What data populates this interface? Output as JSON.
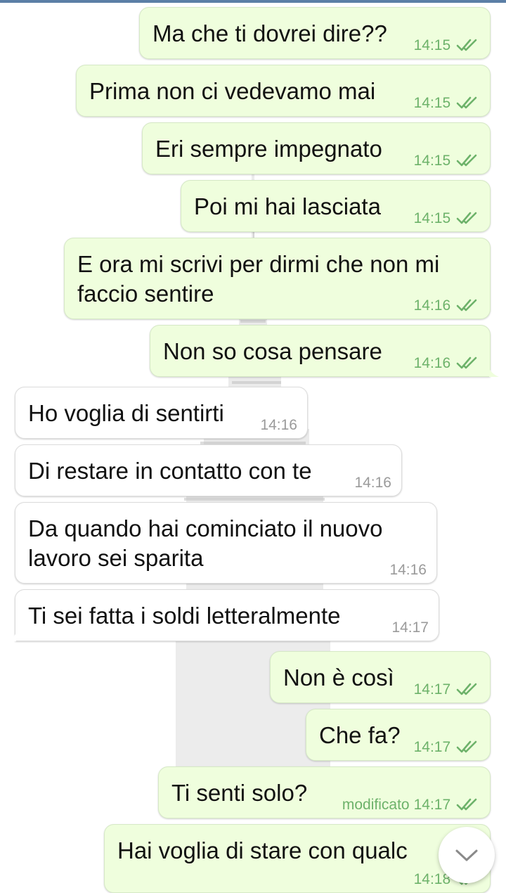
{
  "colors": {
    "outgoing_bubble": "#effedd",
    "incoming_bubble": "#ffffff",
    "outgoing_meta": "#6db26a",
    "incoming_meta": "#9a9a9a",
    "top_strip": "#5b7fa6"
  },
  "messages": [
    {
      "direction": "out",
      "text": "Ma che ti dovrei dire??",
      "time": "14:15",
      "status_icon": "double-check-icon"
    },
    {
      "direction": "out",
      "text": "Prima non ci vedevamo mai",
      "time": "14:15",
      "status_icon": "double-check-icon"
    },
    {
      "direction": "out",
      "text": "Eri sempre impegnato",
      "time": "14:15",
      "status_icon": "double-check-icon"
    },
    {
      "direction": "out",
      "text": "Poi mi hai lasciata",
      "time": "14:15",
      "status_icon": "double-check-icon"
    },
    {
      "direction": "out",
      "text": "E ora mi scrivi per dirmi che non mi faccio sentire",
      "time": "14:16",
      "status_icon": "double-check-icon"
    },
    {
      "direction": "out",
      "text": "Non so cosa pensare",
      "time": "14:16",
      "status_icon": "double-check-icon"
    },
    {
      "direction": "in",
      "text": "Ho voglia di sentirti",
      "time": "14:16"
    },
    {
      "direction": "in",
      "text": "Di restare in contatto con te",
      "time": "14:16"
    },
    {
      "direction": "in",
      "text": "Da quando hai cominciato il nuovo lavoro sei sparita",
      "time": "14:16"
    },
    {
      "direction": "in",
      "text": "Ti sei fatta i soldi letteralmente",
      "time": "14:17"
    },
    {
      "direction": "out",
      "text": "Non è così",
      "time": "14:17",
      "status_icon": "double-check-icon"
    },
    {
      "direction": "out",
      "text": "Che fa?",
      "time": "14:17",
      "status_icon": "double-check-icon"
    },
    {
      "direction": "out",
      "text": "Ti senti solo?",
      "time": "14:17",
      "edited_label": "modificato",
      "status_icon": "double-check-icon"
    },
    {
      "direction": "out",
      "text": "Hai voglia di stare con qualc",
      "time": "14:18",
      "status_icon": "double-check-icon"
    }
  ],
  "scroll_down_button": {
    "icon": "chevron-down-icon"
  }
}
